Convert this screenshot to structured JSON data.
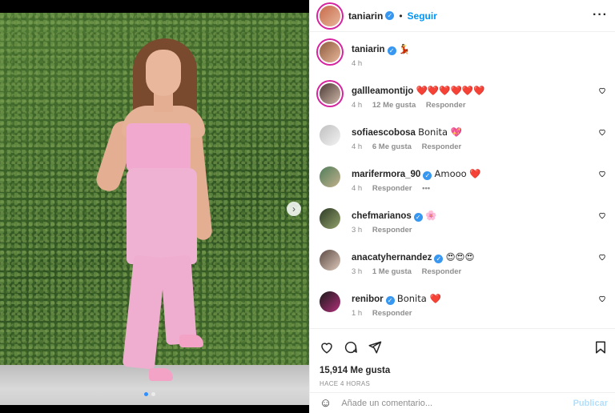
{
  "header": {
    "username": "taniarin",
    "separator": "•",
    "follow_label": "Seguir",
    "more_icon": "more-horizontal-icon"
  },
  "caption": {
    "username": "taniarin",
    "emoji": "💃",
    "time": "4 h"
  },
  "comments": [
    {
      "username": "gallleamontijo",
      "text": "❤️❤️❤️❤️❤️❤️",
      "time": "4 h",
      "likes": "12 Me gusta",
      "reply": "Responder",
      "extra": ""
    },
    {
      "username": "sofiaescobosa",
      "text": "Bonita 💖",
      "time": "4 h",
      "likes": "6 Me gusta",
      "reply": "Responder",
      "extra": ""
    },
    {
      "username": "marifermora_90",
      "text": "Amooo ❤️",
      "time": "4 h",
      "likes": "",
      "reply": "Responder",
      "extra": "•••"
    },
    {
      "username": "chefmarianos",
      "text": "🌸",
      "time": "3 h",
      "likes": "",
      "reply": "Responder",
      "extra": ""
    },
    {
      "username": "anacatyhernandez",
      "text": "😍😍😍",
      "time": "3 h",
      "likes": "1 Me gusta",
      "reply": "Responder",
      "extra": ""
    },
    {
      "username": "renibor",
      "text": "Bonita ❤️",
      "time": "1 h",
      "likes": "",
      "reply": "Responder",
      "extra": ""
    }
  ],
  "actions": {
    "likes": "15,914 Me gusta",
    "ago": "HACE 4 HORAS"
  },
  "composer": {
    "placeholder": "Añade un comentario...",
    "publish_label": "Publicar"
  },
  "colors": {
    "accent": "#0095f6",
    "verified": "#3897f0",
    "muted": "#8e8e8e",
    "text": "#262626"
  }
}
